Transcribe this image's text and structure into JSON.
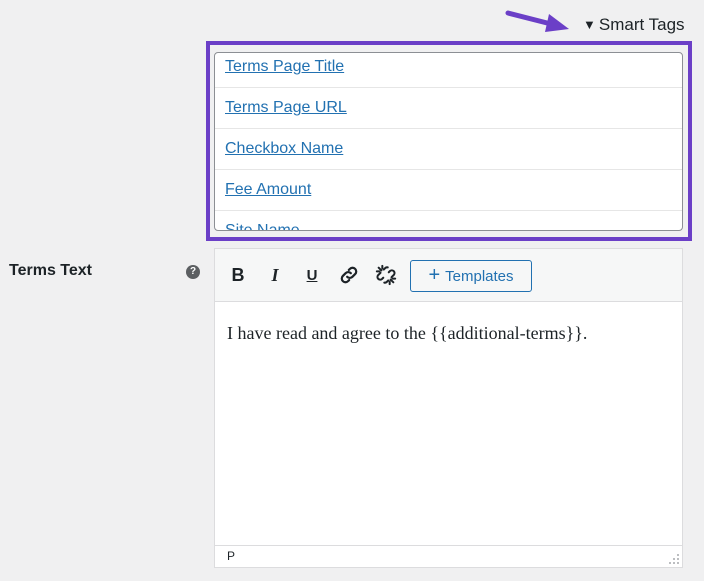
{
  "smart_tags": {
    "toggle_label": "Smart Tags",
    "toggle_indicator": "▼",
    "items": [
      {
        "label": "Terms Page Title"
      },
      {
        "label": "Terms Page URL"
      },
      {
        "label": "Checkbox Name"
      },
      {
        "label": "Fee Amount"
      },
      {
        "label": "Site Name"
      }
    ]
  },
  "field": {
    "label": "Terms Text",
    "help_icon_glyph": "?"
  },
  "editor": {
    "toolbar": {
      "bold_label": "B",
      "italic_label": "I",
      "underline_label": "U",
      "templates_plus": "+",
      "templates_label": "Templates"
    },
    "content": "I have read and agree to the {{additional-terms}}.",
    "status_path": "P"
  },
  "colors": {
    "accent": "#2271b1",
    "annotation": "#6b3fc7",
    "background": "#f0f0f1"
  }
}
